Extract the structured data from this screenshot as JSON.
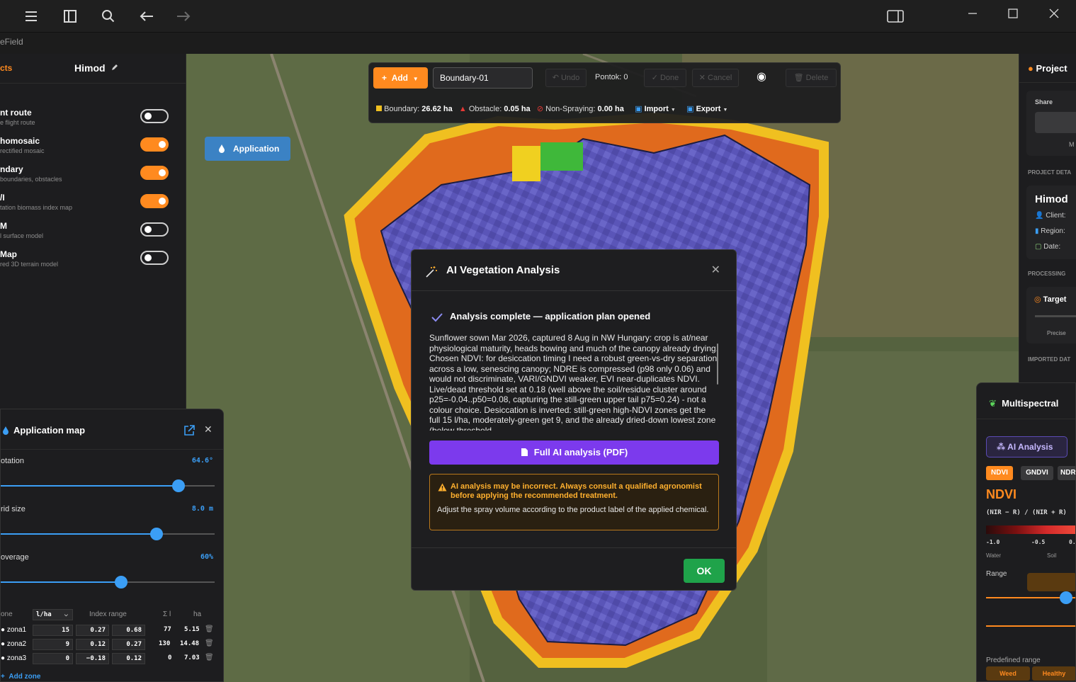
{
  "window": {
    "app_name_partial": "eField"
  },
  "left_panel": {
    "tab_projects": "cts",
    "project_name": "Himod",
    "layers": [
      {
        "title": "nt route",
        "subtitle": "e flight route",
        "on": false
      },
      {
        "title": "homosaic",
        "subtitle": "rectified mosaic",
        "on": true
      },
      {
        "title": "ndary",
        "subtitle": "boundaries, obstacles",
        "on": true
      },
      {
        "title": "/I",
        "subtitle": "tation biomass index map",
        "on": true
      },
      {
        "title": "M",
        "subtitle": "l surface model",
        "on": false
      },
      {
        "title": "Map",
        "subtitle": "red 3D terrain model",
        "on": false
      }
    ]
  },
  "toolbar": {
    "add_label": "Add",
    "boundary_name": "Boundary-01",
    "undo_label": "Undo",
    "pontok_label": "Pontok: 0",
    "done_label": "Done",
    "cancel_label": "Cancel",
    "delete_label": "Delete",
    "boundary_label": "Boundary:",
    "boundary_value": "26.62 ha",
    "obstacle_label": "Obstacle:",
    "obstacle_value": "0.05 ha",
    "nonspray_label": "Non-Spraying:",
    "nonspray_value": "0.00 ha",
    "import_label": "Import",
    "export_label": "Export"
  },
  "application_button": "Application",
  "modal": {
    "title": "AI Vegetation Analysis",
    "complete": "Analysis complete — application plan opened",
    "summary": "Sunflower sown Mar 2026, captured 8 Aug in NW Hungary: crop is at/near physiological maturity, heads bowing and much of the canopy already drying. Chosen NDVI: for desiccation timing I need a robust green-vs-dry separation across a low, senescing canopy; NDRE is compressed (p98 only 0.06) and would not discriminate, VARI/GNDVI weaker, EVI near-duplicates NDVI. Live/dead threshold set at 0.18 (well above the soil/residue cluster around p25=-0.04..p50=0.08, capturing the still-green upper tail p75=0.24) - not a colour choice. Desiccation is inverted: still-green high-NDVI zones get the full 15 l/ha, moderately-green get 9, and the already dried-down lowest zone (below threshold",
    "pdf_button": "Full AI analysis (PDF)",
    "warning_bold": "AI analysis may be incorrect. Always consult a qualified agronomist before applying the recommended treatment.",
    "warning_text": "Adjust the spray volume according to the product label of the applied chemical.",
    "ok": "OK"
  },
  "application_map": {
    "title": "Application map",
    "sliders": [
      {
        "label": "otation",
        "value": "64.6°",
        "fraction": 0.83
      },
      {
        "label": "rid size",
        "value": "8.0 m",
        "fraction": 0.73
      },
      {
        "label": "overage",
        "value": "60%",
        "fraction": 0.56
      }
    ],
    "table_headers": {
      "zone": "one",
      "unit": "l/ha",
      "range": "Index range",
      "sum": "Σ l",
      "ha": "ha"
    },
    "zones": [
      {
        "name": "zona1",
        "rate": "15",
        "min": "0.27",
        "max": "0.68",
        "sum": "77",
        "ha": "5.15"
      },
      {
        "name": "zona2",
        "rate": "9",
        "min": "0.12",
        "max": "0.27",
        "sum": "130",
        "ha": "14.48"
      },
      {
        "name": "zona3",
        "rate": "0",
        "min": "−0.18",
        "max": "0.12",
        "sum": "0",
        "ha": "7.03"
      }
    ],
    "add_zone": "Add zone"
  },
  "right_panel": {
    "project": "Project",
    "share": "Share",
    "m_text": "M",
    "project_details": "PROJECT DETA",
    "project_name": "Himod",
    "client": "Client:",
    "region": "Region:",
    "date": "Date:",
    "processing": "PROCESSING",
    "target": "Target",
    "precise": "Precise",
    "imported": "IMPORTED DAT"
  },
  "multispectral": {
    "title": "Multispectral",
    "ai_analysis": "AI Analysis",
    "tabs": [
      "NDVI",
      "GNDVI",
      "NDR"
    ],
    "index_name": "NDVI",
    "formula": "(NIR − R) / (NIR + R)",
    "scale": [
      "-1.0",
      "-0.5",
      "0."
    ],
    "scale_labels": [
      "Water",
      "Soil"
    ],
    "range": "Range",
    "predefined": "Predefined range",
    "preset_weed": "Weed",
    "preset_healthy": "Healthy"
  }
}
